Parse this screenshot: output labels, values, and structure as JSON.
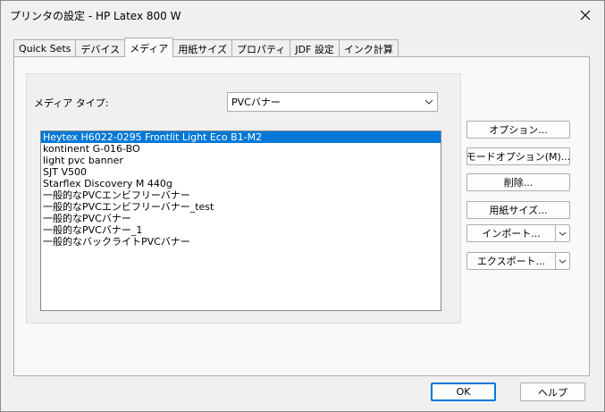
{
  "window": {
    "title": "プリンタの設定 - HP Latex 800 W"
  },
  "tabs": [
    {
      "label": "Quick Sets"
    },
    {
      "label": "デバイス"
    },
    {
      "label": "メディア"
    },
    {
      "label": "用紙サイズ"
    },
    {
      "label": "プロパティ"
    },
    {
      "label": "JDF 設定"
    },
    {
      "label": "インク計算"
    }
  ],
  "active_tab": "メディア",
  "media": {
    "type_label": "メディア タイプ:",
    "type_value": "PVCバナー",
    "items": [
      "Heytex H6022-0295 Frontlit Light Eco B1-M2",
      "kontinent G-016-BO",
      "light pvc banner",
      "SJT V500",
      "Starflex Discovery M 440g",
      "一般的なPVCエンビフリーバナー",
      "一般的なPVCエンビフリーバナー_test",
      "一般的なPVCバナー",
      "一般的なPVCバナー_1",
      "一般的なバックライトPVCバナー"
    ],
    "selected_index": 0
  },
  "side_buttons": {
    "options": "オプション...",
    "mode_options": "モードオプション(M)...",
    "delete": "削除...",
    "paper_size": "用紙サイズ...",
    "import": "インポート...",
    "export": "エクスポート..."
  },
  "footer": {
    "ok": "OK",
    "help": "ヘルプ"
  },
  "colors": {
    "selection": "#0078d7",
    "default_button_border": "#0078d7"
  }
}
